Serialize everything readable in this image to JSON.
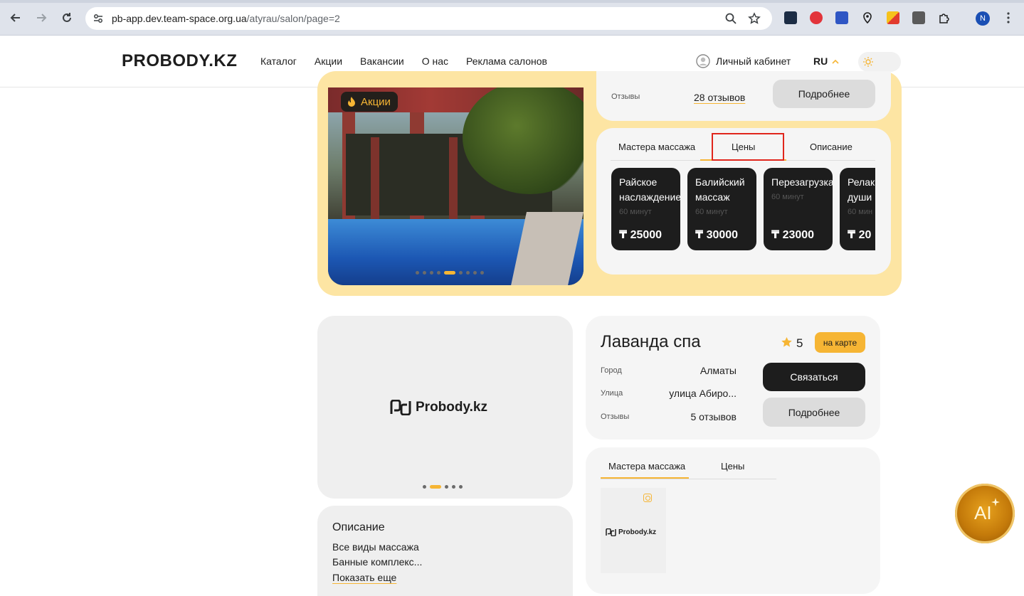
{
  "browser": {
    "url_host": "pb-app.dev.team-space.org.ua",
    "url_path": "/atyrau/salon/page=2",
    "profile_initial": "N"
  },
  "header": {
    "logo": "PROBODY.KZ",
    "nav": [
      "Каталог",
      "Акции",
      "Вакансии",
      "О нас",
      "Реклама салонов"
    ],
    "cabinet_label": "Личный кабинет",
    "lang": "RU"
  },
  "salon1": {
    "promo_badge": "Акции",
    "reviews_label": "Отзывы",
    "reviews_value": "28 отзывов",
    "more_button": "Подробнее",
    "tabs": [
      "Мастера массажа",
      "Цены",
      "Описание"
    ],
    "active_tab": "Цены",
    "prices": [
      {
        "name_lines": [
          "Райское",
          "наслаждение"
        ],
        "duration": "60 минут",
        "price": "₸ 25000"
      },
      {
        "name_lines": [
          "Балийский",
          "массаж"
        ],
        "duration": "60 минут",
        "price": "₸ 30000"
      },
      {
        "name_lines": [
          "Перезагрузка"
        ],
        "duration": "60 минут",
        "price": "₸ 23000"
      },
      {
        "name_lines": [
          "Релак",
          "души"
        ],
        "duration": "60 мин",
        "price": "₸ 20"
      }
    ],
    "slider_total": 9,
    "slider_active": 5
  },
  "salon2": {
    "logo_text": "Probody.kz",
    "title": "Лаванда спа",
    "rating": "5",
    "map_button": "на карте",
    "city_label": "Город",
    "city_value": "Алматы",
    "street_label": "Улица",
    "street_value": "улица Абиро...",
    "reviews_label": "Отзывы",
    "reviews_value": "5 отзывов",
    "contact_button": "Связаться",
    "more_button": "Подробнее",
    "description_title": "Описание",
    "description_lines": [
      "Все виды массажа",
      "Банные комплекс..."
    ],
    "show_more": "Показать еще",
    "tabs": [
      "Мастера массажа",
      "Цены"
    ],
    "active_tab": "Мастера массажа",
    "master_logo_text": "Probody.kz",
    "slider_total": 5,
    "slider_active": 2
  },
  "ai_button": "AI",
  "colors": {
    "accent": "#f6b534",
    "dark": "#1d1d1d",
    "card_yellow": "#fde5a3",
    "highlight_red": "#e0261c"
  }
}
